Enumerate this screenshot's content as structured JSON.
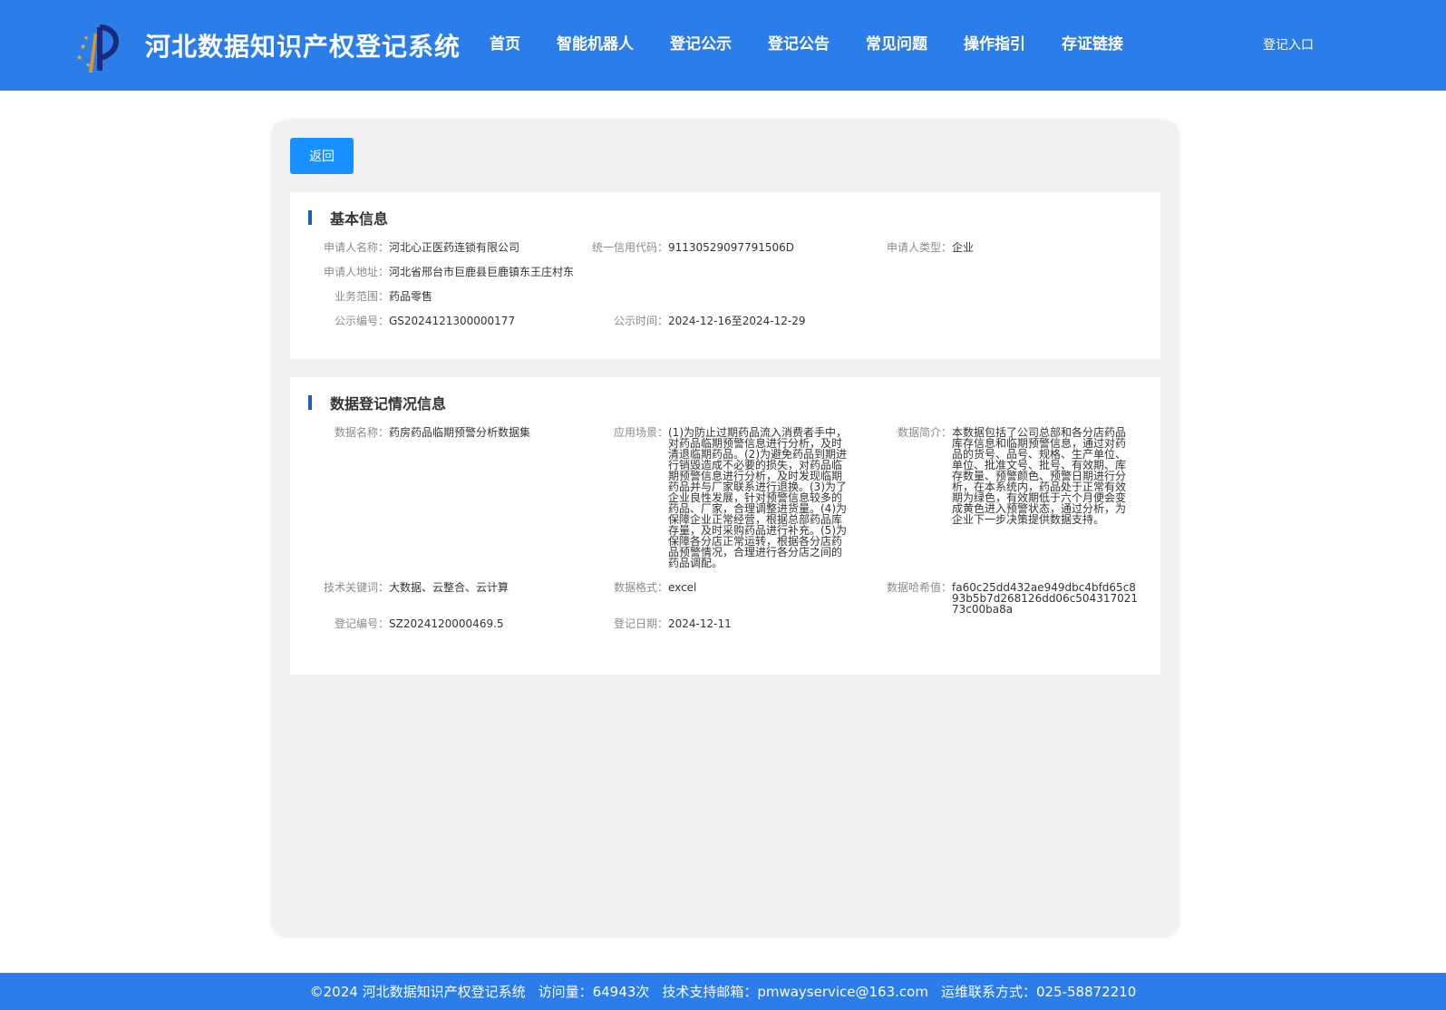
{
  "header": {
    "site_title": "河北数据知识产权登记系统",
    "nav": [
      "首页",
      "智能机器人",
      "登记公示",
      "登记公告",
      "常见问题",
      "操作指引",
      "存证链接"
    ],
    "login_label": "登记入口"
  },
  "toolbar": {
    "back_label": "返回"
  },
  "basic_info": {
    "title": "基本信息",
    "applicant_name_label": "申请人名称：",
    "applicant_name": "河北心正医药连锁有限公司",
    "credit_code_label": "统一信用代码：",
    "credit_code": "91130529097791506D",
    "applicant_type_label": "申请人类型：",
    "applicant_type": "企业",
    "address_label": "申请人地址：",
    "address": "河北省邢台市巨鹿县巨鹿镇东王庄村东",
    "business_scope_label": "业务范围：",
    "business_scope": "药品零售",
    "notice_no_label": "公示编号：",
    "notice_no": "GS2024121300000177",
    "notice_time_label": "公示时间：",
    "notice_time": "2024-12-16至2024-12-29"
  },
  "registration_info": {
    "title": "数据登记情况信息",
    "data_name_label": "数据名称：",
    "data_name": "药房药品临期预警分析数据集",
    "scenario_label": "应用场景：",
    "scenario": "(1)为防止过期药品流入消费者手中，对药品临期预警信息进行分析，及时清退临期药品。(2)为避免药品到期进行销毁造成不必要的损失，对药品临期预警信息进行分析，及时发现临期药品并与厂家联系进行退换。(3)为了企业良性发展，针对预警信息较多的药品、厂家，合理调整进货量。(4)为保障企业正常经营，根据总部药品库存量，及时采购药品进行补充。(5)为保障各分店正常运转，根据各分店药品预警情况，合理进行各分店之间的药品调配。",
    "summary_label": "数据简介：",
    "summary": "本数据包括了公司总部和各分店药品库存信息和临期预警信息，通过对药品的货号、品号、规格、生产单位、单位、批准文号、批号、有效期、库存数量、预警颜色、预警日期进行分析，在本系统内，药品处于正常有效期为绿色，有效期低于六个月便会变成黄色进入预警状态，通过分析，为企业下一步决策提供数据支持。",
    "keywords_label": "技术关键词：",
    "keywords": "大数据、云整合、云计算",
    "format_label": "数据格式：",
    "format": "excel",
    "hash_label": "数据哈希值：",
    "hash": "fa60c25dd432ae949dbc4bfd65c893b5b7d268126dd06c50431702173c00ba8a",
    "reg_no_label": "登记编号：",
    "reg_no": "SZ2024120000469.5",
    "reg_date_label": "登记日期：",
    "reg_date": "2024-12-11"
  },
  "footer": {
    "copyright": "©2024 河北数据知识产权登记系统",
    "visits": "访问量：64943次",
    "support": "技术支持邮箱：pmwayservice@163.com",
    "ops": "运维联系方式：025-58872210"
  },
  "colors": {
    "brand": "#2b7de9",
    "button": "#1890ff",
    "accent_bar": "#1e5fbf"
  }
}
